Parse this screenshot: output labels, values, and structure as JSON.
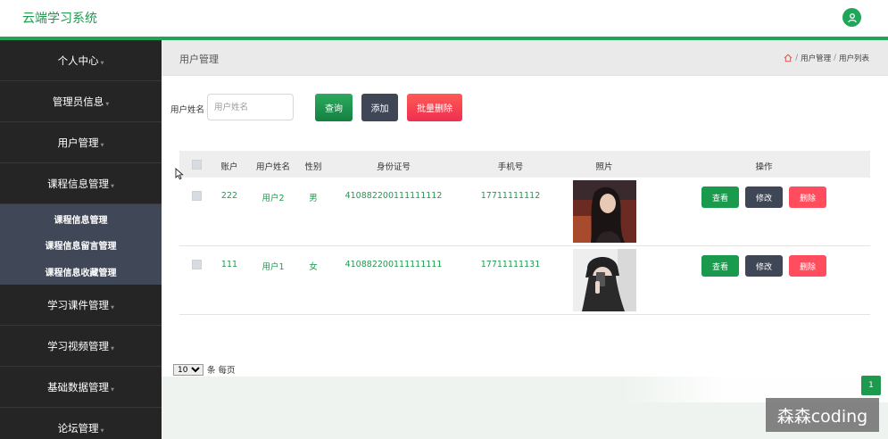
{
  "app": {
    "title": "云端学习系统"
  },
  "icons": {
    "user": "user-icon",
    "home": "home-icon",
    "cursor": "mouse-pointer-icon"
  },
  "sidebar": {
    "items": [
      {
        "label": "个人中心"
      },
      {
        "label": "管理员信息"
      },
      {
        "label": "用户管理"
      },
      {
        "label": "课程信息管理"
      },
      {
        "label": "学习课件管理"
      },
      {
        "label": "学习视频管理"
      },
      {
        "label": "基础数据管理"
      },
      {
        "label": "论坛管理"
      }
    ],
    "submenu": [
      {
        "label": "课程信息管理"
      },
      {
        "label": "课程信息留言管理"
      },
      {
        "label": "课程信息收藏管理"
      }
    ]
  },
  "page": {
    "title": "用户管理",
    "breadcrumb": [
      "用户管理",
      "用户列表"
    ]
  },
  "search": {
    "label": "用户姓名",
    "placeholder": "用户姓名"
  },
  "buttons": {
    "query": "查询",
    "add": "添加",
    "batch_delete": "批量删除"
  },
  "table": {
    "headers": {
      "account": "账户",
      "name": "用户姓名",
      "gender": "性别",
      "id_number": "身份证号",
      "phone": "手机号",
      "photo": "照片",
      "actions": "操作"
    },
    "rows": [
      {
        "account": "222",
        "name": "用户2",
        "gender": "男",
        "id_number": "410882200111111112",
        "phone": "17711111112"
      },
      {
        "account": "111",
        "name": "用户1",
        "gender": "女",
        "id_number": "410882200111111111",
        "phone": "17711111131"
      }
    ],
    "row_actions": {
      "view": "查看",
      "edit": "修改",
      "delete": "删除"
    }
  },
  "pagination": {
    "page_size": "10",
    "per_page_label": "条 每页",
    "current_page": "1"
  },
  "watermark": "森森coding",
  "colors": {
    "brand": "#1e9a4f",
    "sidebar_bg": "#252525",
    "submenu_bg": "#404757",
    "danger": "#ff4d5e",
    "dark_button": "#3f4656"
  }
}
